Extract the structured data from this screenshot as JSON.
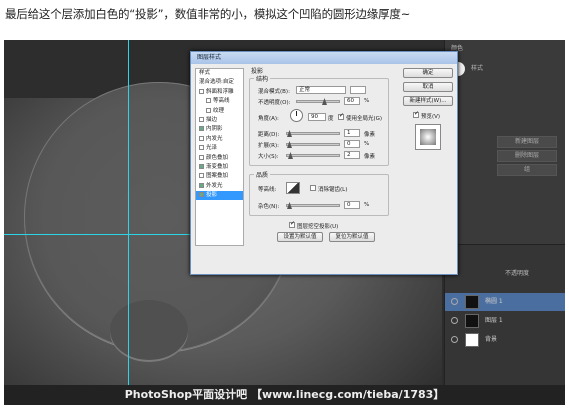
{
  "caption": "最后给这个层添加白色的“投影”，数值非常的小，模拟这个凹陷的圆形边缘厚度~",
  "watermark": "PhotoShop平面设计吧 【www.linecg.com/tieba/1783】",
  "dialog": {
    "title": "图层样式",
    "styles_header": "样式",
    "blend_options": "混合选项:自定",
    "styles": [
      {
        "label": "斜面和浮雕",
        "checked": false
      },
      {
        "label": "等高线",
        "checked": false
      },
      {
        "label": "纹理",
        "checked": false
      },
      {
        "label": "描边",
        "checked": false
      },
      {
        "label": "内阴影",
        "checked": true
      },
      {
        "label": "内发光",
        "checked": false
      },
      {
        "label": "光泽",
        "checked": false
      },
      {
        "label": "颜色叠加",
        "checked": false
      },
      {
        "label": "渐变叠加",
        "checked": true
      },
      {
        "label": "图案叠加",
        "checked": false
      },
      {
        "label": "外发光",
        "checked": true
      },
      {
        "label": "投影",
        "checked": true
      }
    ],
    "section_title": "投影",
    "structure_title": "结构",
    "blend_mode_label": "混合模式(B):",
    "blend_mode_value": "正常",
    "opacity_label": "不透明度(O):",
    "opacity_value": "60",
    "angle_label": "角度(A):",
    "angle_value": "90",
    "angle_unit": "度",
    "global_light_label": "使用全局光(G)",
    "distance_label": "距离(D):",
    "distance_value": "1",
    "spread_label": "扩展(R):",
    "spread_value": "0",
    "size_label": "大小(S):",
    "size_value": "2",
    "px_unit": "像素",
    "percent_unit": "%",
    "quality_title": "品质",
    "contour_label": "等高线:",
    "antialias_label": "消除锯齿(L)",
    "noise_label": "杂色(N):",
    "noise_value": "0",
    "knockout_label": "图层挖空投影(U)",
    "set_default": "设置为默认值",
    "reset_default": "复位为默认值",
    "ok": "确定",
    "cancel": "取消",
    "new_style": "新建样式(W)...",
    "preview_label": "预览(V)"
  },
  "panel": {
    "top_labels": [
      "颜色",
      "色板",
      "样式"
    ],
    "buttons": [
      "新建图层",
      "删除图层",
      "组"
    ],
    "layers": [
      {
        "name": "椭圆 1",
        "selected": true,
        "thumb": "dark"
      },
      {
        "name": "图层 1",
        "selected": false,
        "thumb": "dark"
      },
      {
        "name": "背景",
        "selected": false,
        "thumb": "white"
      }
    ],
    "opacity_label": "不透明度"
  }
}
